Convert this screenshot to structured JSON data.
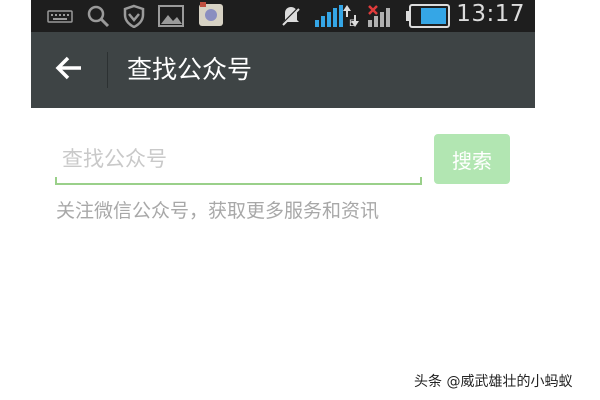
{
  "status_bar": {
    "time": "13:17",
    "icons": [
      "keyboard-icon",
      "search-icon",
      "shield-icon",
      "image-icon",
      "app-icon",
      "mute-icon",
      "signal-icon",
      "data-transfer-icon",
      "signal-icon-2",
      "battery-icon"
    ]
  },
  "header": {
    "back_icon": "arrow-left-icon",
    "title": "查找公众号"
  },
  "search": {
    "placeholder": "查找公众号",
    "value": "",
    "button_label": "搜索"
  },
  "hint": "关注微信公众号，获取更多服务和资讯",
  "watermark": "头条 @威武雄壮的小蚂蚁",
  "colors": {
    "status_bar": "#1e1e1e",
    "header": "#3e4445",
    "accent_green": "#9ad08a",
    "button_disabled": "#b2e6b2"
  }
}
